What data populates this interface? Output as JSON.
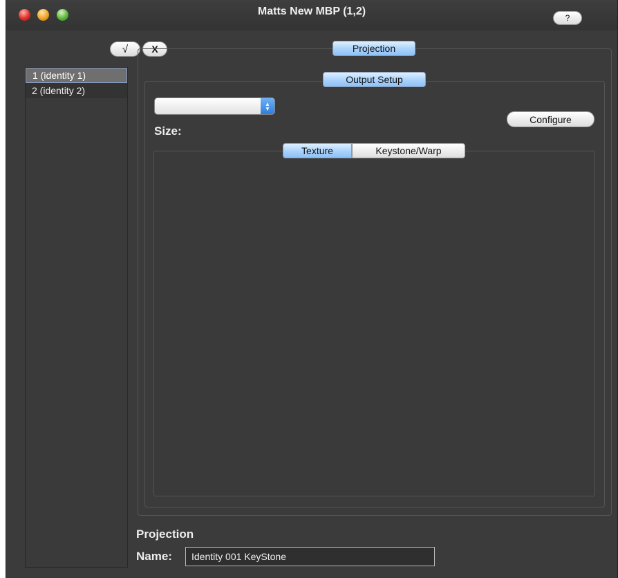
{
  "window": {
    "title": "Matts New MBP (1,2)",
    "help_label": "?"
  },
  "toolbar": {
    "accept_label": "√",
    "cancel_label": "X"
  },
  "sidebar": {
    "items": [
      {
        "label": "1 (identity 1)",
        "selected": true
      },
      {
        "label": "2 (identity 2)",
        "selected": false
      }
    ]
  },
  "main": {
    "tabs": [
      {
        "label": "Projection",
        "selected": true
      }
    ],
    "output_tab": {
      "label": "Output Setup",
      "selected": true
    },
    "output_select_value": "",
    "size_label": "Size:",
    "configure_label": "Configure",
    "sub_tabs": [
      {
        "label": "Texture",
        "selected": true
      },
      {
        "label": "Keystone/Warp",
        "selected": false
      }
    ]
  },
  "footer": {
    "section_title": "Projection",
    "name_label": "Name:",
    "name_value": "Identity 001 KeyStone"
  },
  "colors": {
    "window_bg": "#3b3b3b",
    "selected_tab": "#a9d2fb",
    "selected_row": "#6f6f6f"
  }
}
